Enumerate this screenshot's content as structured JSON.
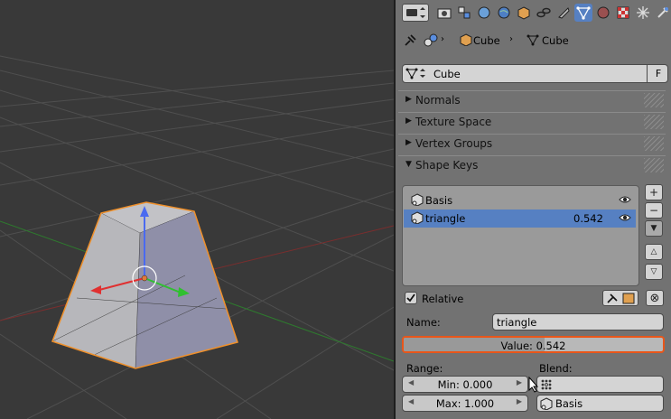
{
  "properties": {
    "breadcrumb": {
      "object": "Cube",
      "mesh": "Cube"
    },
    "datablock": {
      "name": "Cube",
      "fake_user": "F"
    },
    "panels": [
      "Normals",
      "Texture Space",
      "Vertex Groups",
      "Shape Keys"
    ],
    "shape_keys": {
      "items": [
        {
          "name": "Basis",
          "value": ""
        },
        {
          "name": "triangle",
          "value": "0.542"
        }
      ],
      "relative_label": "Relative",
      "name_label": "Name:",
      "name_value": "triangle",
      "value_label": "Value: 0.542",
      "value_fraction": 0.542,
      "range_label": "Range:",
      "min_label": "Min: 0.000",
      "max_label": "Max: 1.000",
      "blend_label": "Blend:",
      "blend_value": "Basis"
    }
  },
  "colors": {
    "accent": "#5680c2",
    "highlight": "#e8561a"
  }
}
